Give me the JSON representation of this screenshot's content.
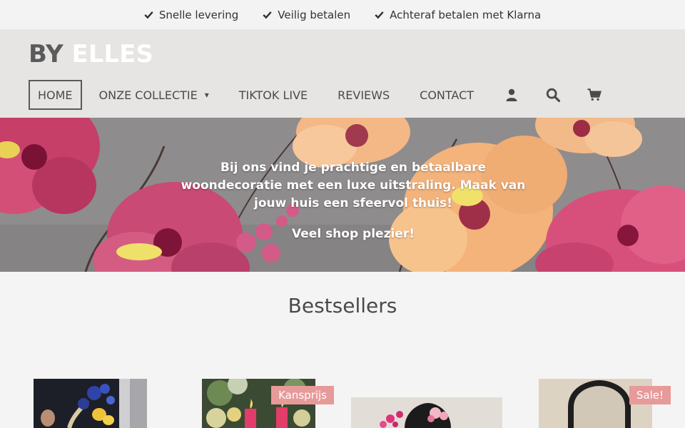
{
  "usps": [
    "Snelle levering",
    "Veilig betalen",
    "Achteraf betalen met Klarna"
  ],
  "logo": {
    "part1": "BY",
    "part2": "ELLES"
  },
  "nav": {
    "items": [
      {
        "label": "HOME"
      },
      {
        "label": "ONZE COLLECTIE",
        "caret": "▾"
      },
      {
        "label": "TIKTOK LIVE"
      },
      {
        "label": "REVIEWS"
      },
      {
        "label": "CONTACT"
      }
    ],
    "icons": [
      "user-icon",
      "search-icon",
      "cart-icon"
    ]
  },
  "hero": {
    "paragraph": "Bij ons vind je prachtige en betaalbare woondecoratie met een luxe uitstraling. Maak van jouw huis een sfeervol thuis!",
    "tagline": "Veel shop plezier!"
  },
  "section": {
    "title": "Bestsellers"
  },
  "products": [
    {
      "badge": ""
    },
    {
      "badge": "Kansprijs"
    },
    {
      "badge": ""
    },
    {
      "badge": "Sale!"
    }
  ],
  "colors": {
    "badge": "#e79a9a",
    "header": "#e7e5e4",
    "accent_text": "#4a4a4a"
  }
}
